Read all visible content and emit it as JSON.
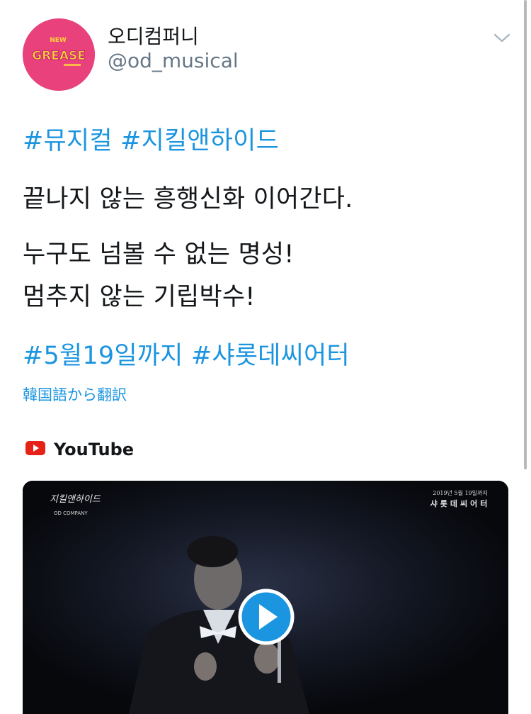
{
  "profile": {
    "display_name": "오디컴퍼니",
    "handle": "@od_musical",
    "avatar_color": "#e8417b",
    "avatar_logo_text": "GREASE",
    "avatar_logo_small": "NEW"
  },
  "tweet": {
    "line1": "#뮤지컬 #지킬앤하이드",
    "line2": "끝나지 않는 흥행신화 이어간다.",
    "line3": "누구도 넘볼 수 없는 명성!",
    "line4": "멈추지 않는 기립박수!",
    "line5": "#5월19일까지 #샤롯데씨어터",
    "translate_link": "韓国語から翻訳",
    "hashtag_color": "#1b95e0"
  },
  "card": {
    "source_label": "YouTube",
    "source_icon": "youtube-icon",
    "video": {
      "overlay_title": "지킬앤하이드",
      "overlay_company": "OD COMPANY",
      "overlay_date": "2019년 5월 19일까지",
      "overlay_venue": "샤롯데씨어터",
      "play_icon": "play-icon"
    }
  },
  "controls": {
    "caret_icon": "chevron-down-icon"
  }
}
